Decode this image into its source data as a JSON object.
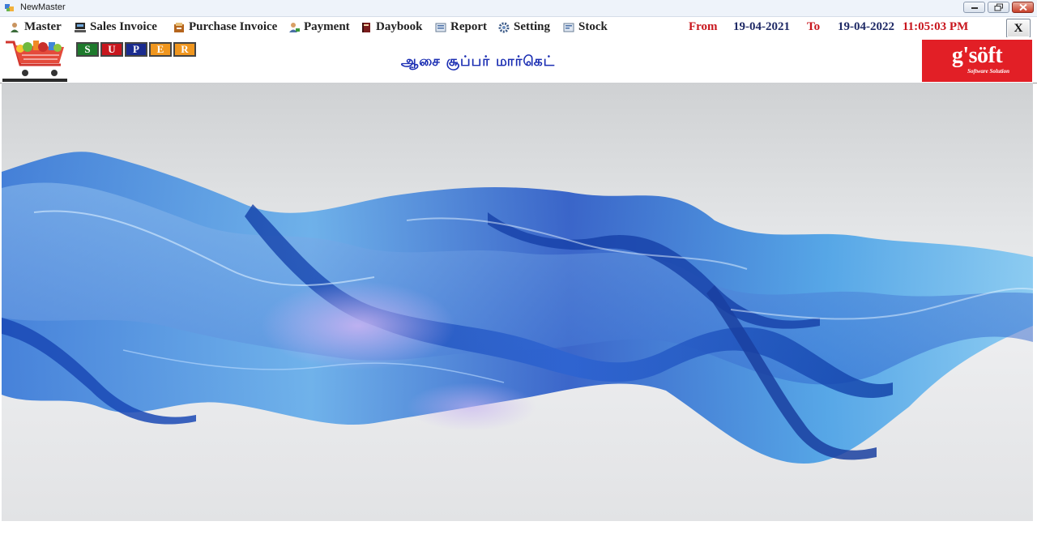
{
  "window": {
    "title": "NewMaster"
  },
  "menu": [
    {
      "label": "Master",
      "icon": "user-icon"
    },
    {
      "label": "Sales Invoice",
      "icon": "register-icon"
    },
    {
      "label": "Purchase Invoice",
      "icon": "purchase-icon"
    },
    {
      "label": "Payment",
      "icon": "payment-icon"
    },
    {
      "label": "Daybook",
      "icon": "book-icon"
    },
    {
      "label": "Report",
      "icon": "report-icon"
    },
    {
      "label": "Setting",
      "icon": "gear-icon"
    },
    {
      "label": "Stock",
      "icon": "stock-icon"
    }
  ],
  "date_range": {
    "from_label": "From",
    "from_date": "19-04-2021",
    "to_label": "To",
    "to_date": "19-04-2022",
    "time": "11:05:03 PM"
  },
  "close_button": "X",
  "brand": {
    "letters": [
      "S",
      "U",
      "P",
      "E",
      "R"
    ],
    "letter_colors": [
      "#1e7a2c",
      "#c8161d",
      "#1b2c8f",
      "#f0961e",
      "#f0961e"
    ],
    "shop_name": "ஆசை சூப்பர் மார்கெட்",
    "vendor_name": "g'söft",
    "vendor_tagline": "Software Solution",
    "vendor_color": "#e21f26"
  }
}
